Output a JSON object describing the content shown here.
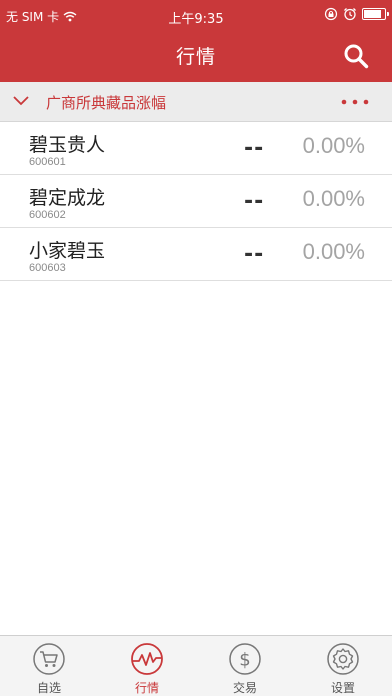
{
  "status_bar": {
    "carrier": "无 SIM 卡",
    "wifi_icon": "wifi-icon",
    "time": "上午9:35",
    "icons": [
      "orientation-lock-icon",
      "alarm-icon",
      "battery-icon"
    ],
    "battery_level": 0.9
  },
  "nav": {
    "title": "行情",
    "search_icon": "search-icon"
  },
  "section": {
    "title": "广商所典藏品涨幅",
    "expand_icon": "chevron-down-icon",
    "more_icon": "more-dots-icon"
  },
  "stocks": [
    {
      "name": "碧玉贵人",
      "code": "600601",
      "price": "--",
      "change": "0.00%"
    },
    {
      "name": "碧定成龙",
      "code": "600602",
      "price": "--",
      "change": "0.00%"
    },
    {
      "name": "小家碧玉",
      "code": "600603",
      "price": "--",
      "change": "0.00%"
    }
  ],
  "tabs": [
    {
      "label": "自选",
      "icon": "cart-icon",
      "active": false
    },
    {
      "label": "行情",
      "icon": "market-chart-icon",
      "active": true
    },
    {
      "label": "交易",
      "icon": "dollar-icon",
      "active": false
    },
    {
      "label": "设置",
      "icon": "settings-gear-icon",
      "active": false
    }
  ],
  "colors": {
    "brand_red": "#c9383a",
    "muted_text": "#a4a4a4",
    "section_bg": "#ececec"
  }
}
